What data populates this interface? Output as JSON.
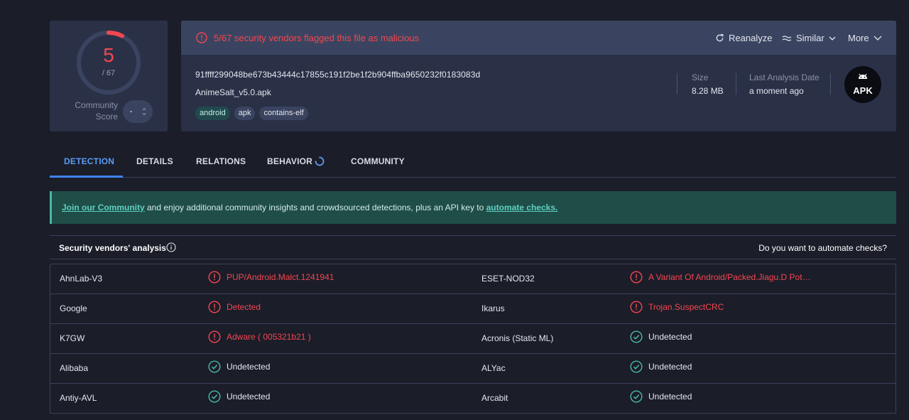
{
  "score": {
    "detections": "5",
    "total": "/ 67",
    "fraction": 0.0746,
    "community_label_line1": "Community",
    "community_label_line2": "Score"
  },
  "alert": {
    "text": "5/67 security vendors flagged this file as malicious",
    "color": "#f4464f"
  },
  "actions": {
    "reanalyze": "Reanalyze",
    "similar": "Similar",
    "more": "More"
  },
  "file": {
    "hash": "91ffff299048be673b43444c17855c191f2be1f2b904ffba9650232f0183083d",
    "name": "AnimeSalt_v5.0.apk",
    "tags": [
      "android",
      "apk",
      "contains-elf"
    ],
    "size_label": "Size",
    "size_value": "8.28 MB",
    "last_label": "Last Analysis Date",
    "last_value": "a moment ago",
    "type_badge": "APK"
  },
  "tabs": [
    "DETECTION",
    "DETAILS",
    "RELATIONS",
    "BEHAVIOR",
    "COMMUNITY"
  ],
  "banner": {
    "link1": "Join our Community",
    "middle": " and enjoy additional community insights and crowdsourced detections, plus an API key to ",
    "link2": "automate checks."
  },
  "vendors": {
    "title": "Security vendors' analysis",
    "automate_question": "Do you want to automate checks?",
    "rows": [
      [
        {
          "vendor": "AhnLab-V3",
          "result": "PUP/Android.Malct.1241941",
          "status": "malicious"
        },
        {
          "vendor": "ESET-NOD32",
          "result": "A Variant Of Android/Packed.Jiagu.D Pot…",
          "status": "malicious"
        }
      ],
      [
        {
          "vendor": "Google",
          "result": "Detected",
          "status": "malicious"
        },
        {
          "vendor": "Ikarus",
          "result": "Trojan.SuspectCRC",
          "status": "malicious"
        }
      ],
      [
        {
          "vendor": "K7GW",
          "result": "Adware ( 005321b21 )",
          "status": "malicious"
        },
        {
          "vendor": "Acronis (Static ML)",
          "result": "Undetected",
          "status": "undetected"
        }
      ],
      [
        {
          "vendor": "Alibaba",
          "result": "Undetected",
          "status": "undetected"
        },
        {
          "vendor": "ALYac",
          "result": "Undetected",
          "status": "undetected"
        }
      ],
      [
        {
          "vendor": "Antiy-AVL",
          "result": "Undetected",
          "status": "undetected"
        },
        {
          "vendor": "Arcabit",
          "result": "Undetected",
          "status": "undetected"
        }
      ]
    ]
  }
}
